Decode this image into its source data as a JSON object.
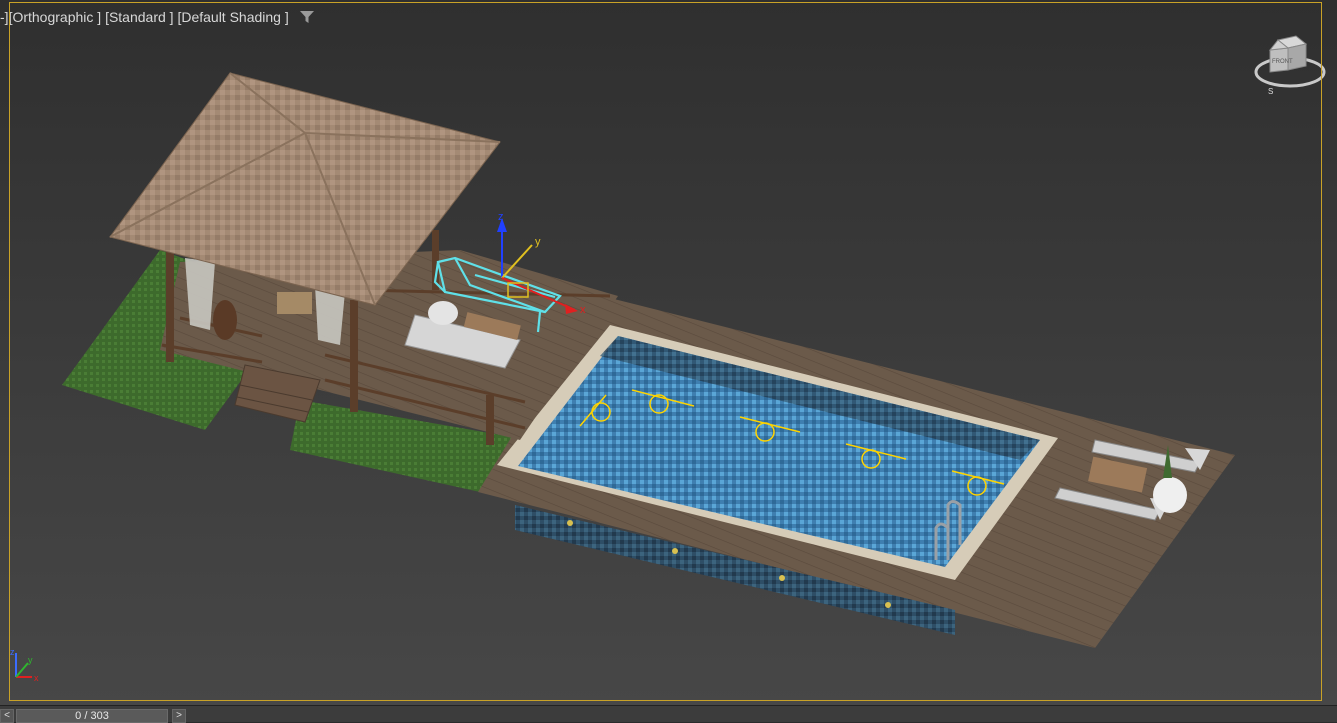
{
  "viewport": {
    "label_prefix": "-]",
    "label_view": "[Orthographic ]",
    "label_mode": "[Standard ]",
    "label_shading": "[Default Shading ]",
    "filter_icon": "funnel-icon",
    "viewcube_face": "FRONT",
    "viewcube_compass_south": "S",
    "gizmo_labels": {
      "x": "x",
      "y": "y",
      "z": "z"
    },
    "corner_axis_labels": {
      "x": "x",
      "y": "y",
      "z": "z"
    },
    "colors": {
      "border": "#c9a227",
      "selection": "#5fe0e8",
      "light": "#ffd400",
      "gizmo_x": "#e02020",
      "gizmo_y": "#e0c020",
      "gizmo_z": "#2040ff"
    }
  },
  "timeline": {
    "prev_label": "<",
    "next_label": ">",
    "frame_display": "0 / 303"
  }
}
